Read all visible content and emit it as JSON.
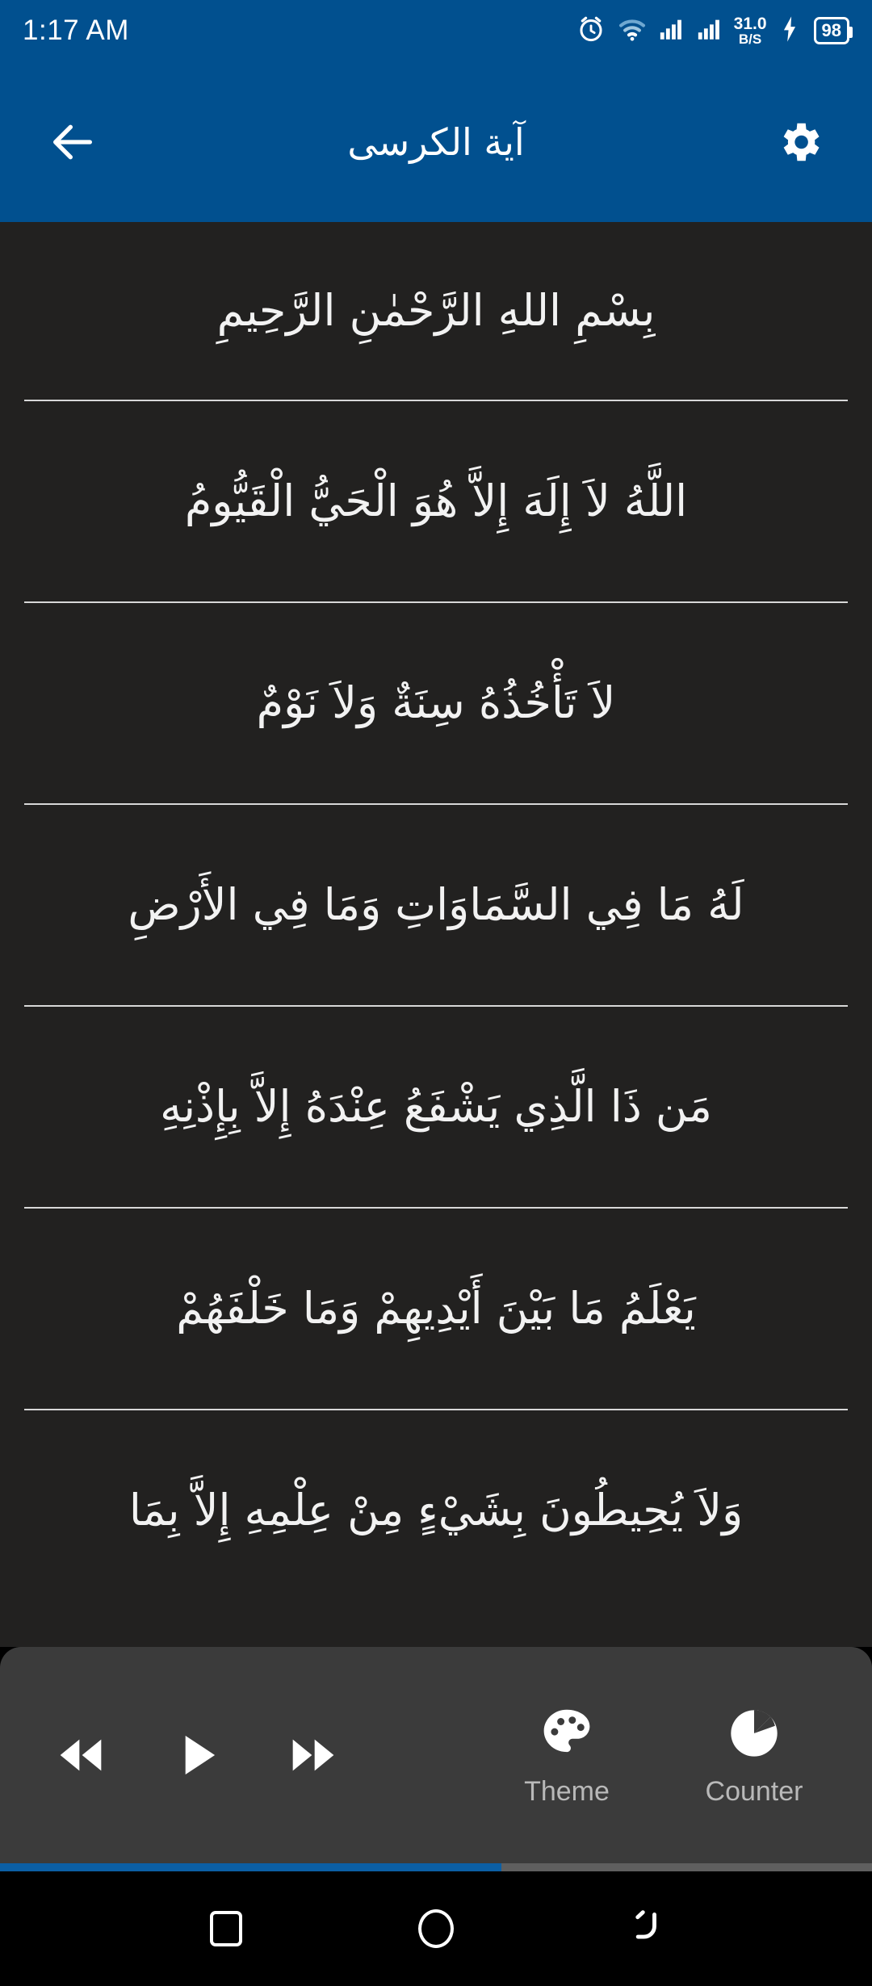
{
  "status_bar": {
    "time": "1:17 AM",
    "network_speed_value": "31.0",
    "network_speed_unit": "B/S",
    "battery_level": "98",
    "icons": [
      "alarm-icon",
      "wifi-icon",
      "signal-sim1-icon",
      "signal-sim2-icon",
      "charging-bolt-icon",
      "battery-icon"
    ]
  },
  "app_bar": {
    "title": "آية الكرسى",
    "back_icon": "arrow-left-icon",
    "settings_icon": "gear-icon",
    "background_color": "#01508f"
  },
  "content": {
    "background_color": "#222120",
    "text_color": "#f2f2f2",
    "verses": [
      "بِسْمِ اللهِ الرَّحْمٰنِ الرَّحِيمِ",
      "اللَّهُ لاَ إِلَهَ إِلاَّ هُوَ الْحَيُّ الْقَيُّومُ",
      "لاَ تَأْخُذُهُ سِنَةٌ وَلاَ نَوْمٌ",
      "لَهُ مَا فِي السَّمَاوَاتِ وَمَا فِي الأَرْضِ",
      "مَن ذَا الَّذِي يَشْفَعُ عِنْدَهُ إِلاَّ بِإِذْنِهِ",
      "يَعْلَمُ مَا بَيْنَ أَيْدِيهِمْ وَمَا خَلْفَهُمْ",
      "وَلاَ يُحِيطُونَ بِشَيْءٍ مِنْ عِلْمِهِ إِلاَّ بِمَا"
    ]
  },
  "player": {
    "background_color": "#3b3b3b",
    "rewind_icon": "rewind-icon",
    "play_icon": "play-icon",
    "forward_icon": "fast-forward-icon",
    "theme": {
      "label": "Theme",
      "icon": "palette-icon"
    },
    "counter": {
      "label": "Counter",
      "icon": "counter-pie-icon"
    },
    "progress_percent": 57.5,
    "progress_color": "#0b5fa5"
  },
  "nav_bar": {
    "recents_icon": "square-recents-icon",
    "home_icon": "circle-home-icon",
    "back_icon": "back-arrow-icon"
  }
}
